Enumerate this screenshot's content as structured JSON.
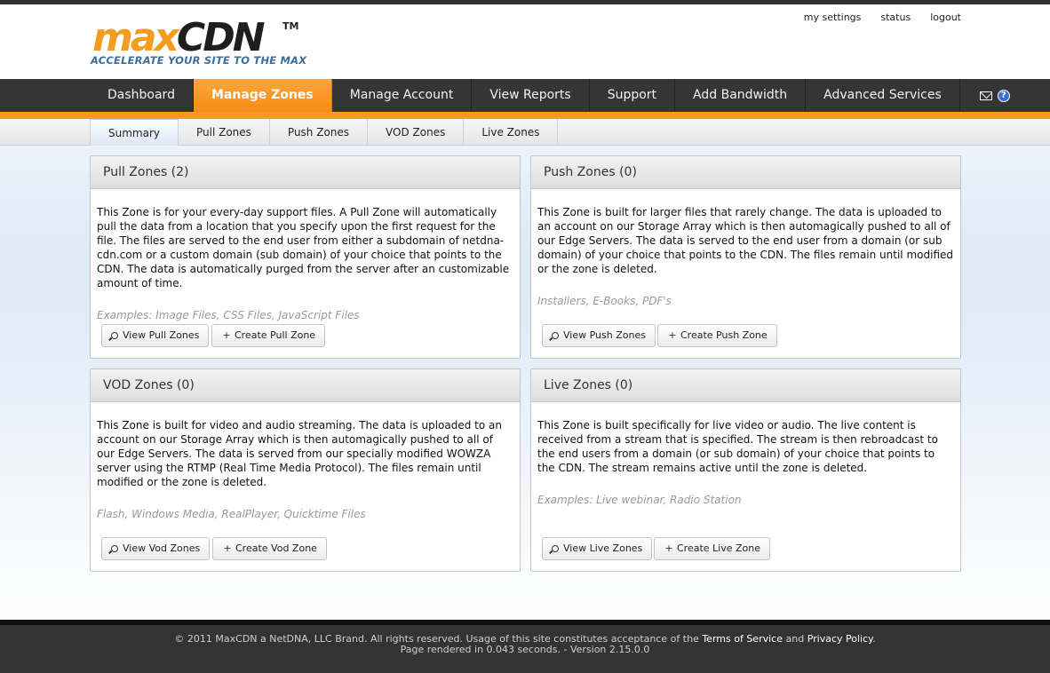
{
  "brand": {
    "logo_max": "max",
    "logo_cdn": "CDN",
    "logo_tm": "TM",
    "tagline": "ACCELERATE YOUR SITE TO THE MAX",
    "colors": {
      "orange": "#f39c1f",
      "dark": "#353535",
      "tagline_blue": "#3c6e9c"
    }
  },
  "toplinks": {
    "settings": "my settings",
    "status": "status",
    "logout": "logout"
  },
  "nav": {
    "items": [
      "Dashboard",
      "Manage Zones",
      "Manage Account",
      "View Reports",
      "Support",
      "Add Bandwidth",
      "Advanced Services"
    ],
    "active": "Manage Zones",
    "icons": [
      "mail-icon",
      "help-icon"
    ],
    "help_glyph": "?"
  },
  "subnav": {
    "items": [
      "Summary",
      "Pull Zones",
      "Push Zones",
      "VOD Zones",
      "Live Zones"
    ],
    "active": "Summary"
  },
  "panels": {
    "pull": {
      "title": "Pull Zones (2)",
      "description": "This Zone is for your every-day support files. A Pull Zone will automatically pull the data from a location that you specify upon the first request for the file. The files are served to the end user from either a subdomain of netdna-cdn.com or a custom domain (sub domain) of your choice that points to the CDN. The data is automatically purged from the server after an customizable amount of time.",
      "examples": "Examples: Image Files, CSS Files, JavaScript Files",
      "view_label": "View Pull Zones",
      "create_label": "Create Pull Zone"
    },
    "push": {
      "title": "Push Zones (0)",
      "description": "This Zone is built for larger files that rarely change. The data is uploaded to an account on our Storage Array which is then automagically pushed to all of our Edge Servers. The data is served to the end user from a domain (or sub domain) of your choice that points to the CDN. The files remain until modified or the zone is deleted.",
      "examples": "Installers, E-Books, PDF's",
      "view_label": "View Push Zones",
      "create_label": "Create Push Zone"
    },
    "vod": {
      "title": "VOD Zones (0)",
      "description": "This Zone is built for video and audio streaming. The data is uploaded to an account on our Storage Array which is then automagically pushed to all of our Edge Servers. The data is served from our specially modified WOWZA server using the RTMP (Real Time Media Protocol). The files remain until modified or the zone is deleted.",
      "examples": "Flash, Windows Media, RealPlayer, Quicktime Files",
      "view_label": "View Vod Zones",
      "create_label": "Create Vod Zone"
    },
    "live": {
      "title": "Live Zones (0)",
      "description": "This Zone is built specifically for live video or audio. The live content is received from a stream that is specified. The stream is then rebroadcast to the end users from a domain (or sub domain) of your choice that points to the CDN. The stream remains active until the zone is deleted.",
      "examples": "Examples: Live webinar, Radio Station",
      "view_label": "View Live Zones",
      "create_label": "Create Live Zone"
    }
  },
  "footer": {
    "line1_prefix": "© 2011 MaxCDN a NetDNA, LLC Brand. All rights reserved. Usage of this site constitutes acceptance of the",
    "terms": "Terms of Service",
    "and": "and",
    "privacy": "Privacy Policy",
    "period": ".",
    "line2": "Page rendered in 0.043 seconds. - Version 2.15.0.0"
  }
}
